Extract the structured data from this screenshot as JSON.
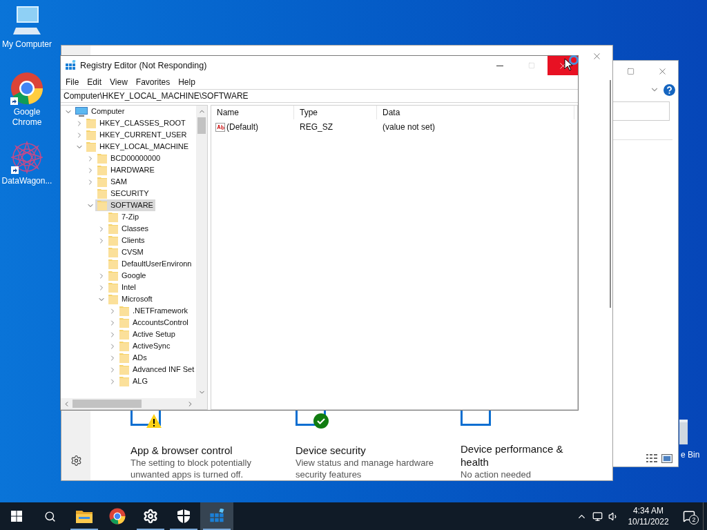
{
  "desktop": {
    "icons": [
      {
        "label": "My Computer",
        "kind": "computer",
        "shortcut": false
      },
      {
        "label": "Google Chrome",
        "kind": "chrome",
        "shortcut": true
      },
      {
        "label": "DataWagon...",
        "kind": "datawagon",
        "shortcut": true
      }
    ],
    "recycle_bin_label": "e Bin"
  },
  "security_window": {
    "cards": [
      {
        "title": "App & browser control",
        "description": "The setting to block potentially unwanted apps is turned off.",
        "kind": "warning"
      },
      {
        "title": "Device security",
        "description": "View status and manage hardware security features",
        "kind": "ok"
      },
      {
        "title": "Device performance & health",
        "description": "No action needed",
        "kind": "plain"
      }
    ]
  },
  "registry_editor": {
    "title": "Registry Editor (Not Responding)",
    "menu": [
      "File",
      "Edit",
      "View",
      "Favorites",
      "Help"
    ],
    "address": "Computer\\HKEY_LOCAL_MACHINE\\SOFTWARE",
    "tree": [
      {
        "label": "Computer",
        "kind": "computer",
        "expanded": true,
        "selected": false,
        "children": [
          {
            "label": "HKEY_CLASSES_ROOT",
            "kind": "branch",
            "expanded": false,
            "selected": false
          },
          {
            "label": "HKEY_CURRENT_USER",
            "kind": "branch",
            "expanded": false,
            "selected": false
          },
          {
            "label": "HKEY_LOCAL_MACHINE",
            "kind": "branch",
            "expanded": true,
            "selected": false,
            "children": [
              {
                "label": "BCD00000000",
                "kind": "branch",
                "expanded": false,
                "selected": false
              },
              {
                "label": "HARDWARE",
                "kind": "branch",
                "expanded": false,
                "selected": false
              },
              {
                "label": "SAM",
                "kind": "branch",
                "expanded": false,
                "selected": false
              },
              {
                "label": "SECURITY",
                "kind": "leaf",
                "selected": false
              },
              {
                "label": "SOFTWARE",
                "kind": "branch",
                "expanded": true,
                "selected": true,
                "children": [
                  {
                    "label": "7-Zip",
                    "kind": "leaf",
                    "selected": false
                  },
                  {
                    "label": "Classes",
                    "kind": "branch",
                    "expanded": false,
                    "selected": false
                  },
                  {
                    "label": "Clients",
                    "kind": "branch",
                    "expanded": false,
                    "selected": false
                  },
                  {
                    "label": "CVSM",
                    "kind": "leaf",
                    "selected": false
                  },
                  {
                    "label": "DefaultUserEnvironn",
                    "kind": "leaf",
                    "selected": false
                  },
                  {
                    "label": "Google",
                    "kind": "branch",
                    "expanded": false,
                    "selected": false
                  },
                  {
                    "label": "Intel",
                    "kind": "branch",
                    "expanded": false,
                    "selected": false
                  },
                  {
                    "label": "Microsoft",
                    "kind": "branch",
                    "expanded": true,
                    "selected": false,
                    "children": [
                      {
                        "label": ".NETFramework",
                        "kind": "branch",
                        "expanded": false,
                        "selected": false
                      },
                      {
                        "label": "AccountsControl",
                        "kind": "branch",
                        "expanded": false,
                        "selected": false
                      },
                      {
                        "label": "Active Setup",
                        "kind": "branch",
                        "expanded": false,
                        "selected": false
                      },
                      {
                        "label": "ActiveSync",
                        "kind": "branch",
                        "expanded": false,
                        "selected": false
                      },
                      {
                        "label": "ADs",
                        "kind": "branch",
                        "expanded": false,
                        "selected": false
                      },
                      {
                        "label": "Advanced INF Set",
                        "kind": "branch",
                        "expanded": false,
                        "selected": false
                      },
                      {
                        "label": "ALG",
                        "kind": "branch",
                        "expanded": false,
                        "selected": false
                      }
                    ]
                  }
                ]
              }
            ]
          }
        ]
      }
    ],
    "columns": [
      "Name",
      "Type",
      "Data"
    ],
    "rows": [
      {
        "name": "(Default)",
        "type": "REG_SZ",
        "data": "(value not set)"
      }
    ]
  },
  "taskbar": {
    "apps": [
      {
        "kind": "explorer",
        "running": true,
        "selected": false
      },
      {
        "kind": "chrome",
        "running": false,
        "selected": false
      },
      {
        "kind": "settings",
        "running": true,
        "selected": false
      },
      {
        "kind": "security",
        "running": true,
        "selected": false
      },
      {
        "kind": "regedit",
        "running": true,
        "selected": true
      }
    ],
    "time": "4:34 AM",
    "date": "10/11/2022",
    "notification_count": "2"
  }
}
